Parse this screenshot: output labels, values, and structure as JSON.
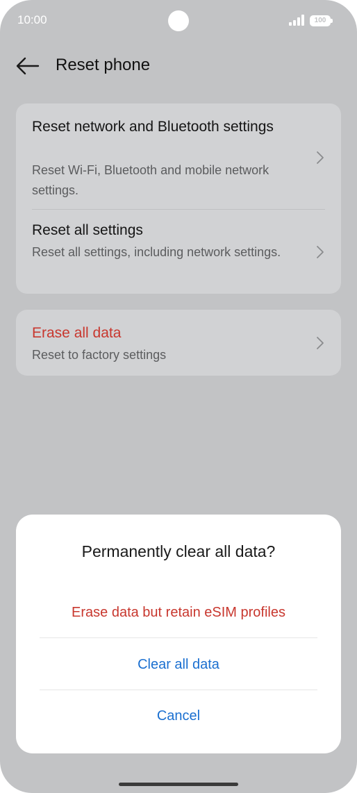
{
  "status_bar": {
    "time": "10:00",
    "battery": "100"
  },
  "header": {
    "title": "Reset phone",
    "back_icon": "arrow-left-icon"
  },
  "settings": [
    {
      "title": "Reset network and Bluetooth settings",
      "subtitle": "Reset Wi-Fi, Bluetooth and mobile network settings."
    },
    {
      "title": "Reset all settings",
      "subtitle": "Reset all settings, including network settings."
    },
    {
      "title": "Erase all data",
      "subtitle": "Reset to factory settings"
    }
  ],
  "dialog": {
    "title": "Permanently clear all data?",
    "options": [
      "Erase data but retain eSIM profiles",
      "Clear all data",
      "Cancel"
    ]
  },
  "colors": {
    "background": "#c2c3c5",
    "card": "#d1d2d4",
    "danger": "#c8372e",
    "accent": "#1a6fd0"
  }
}
